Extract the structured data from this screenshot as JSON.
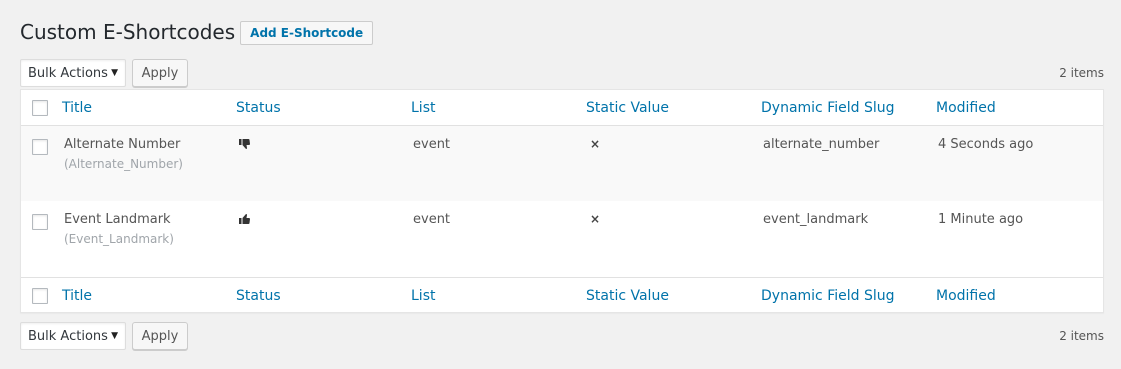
{
  "header": {
    "title": "Custom E-Shortcodes",
    "add_button": "Add E-Shortcode"
  },
  "tablenav_top": {
    "bulk_actions": "Bulk Actions",
    "apply": "Apply",
    "count": "2 items"
  },
  "tablenav_bottom": {
    "bulk_actions": "Bulk Actions",
    "apply": "Apply",
    "count": "2 items"
  },
  "columns": [
    "Title",
    "Status",
    "List",
    "Static Value",
    "Dynamic Field Slug",
    "Modified"
  ],
  "rows": [
    {
      "title": "Alternate Number",
      "shortcode": "(Alternate_Number)",
      "status_icon": "thumbs-down-icon",
      "list": "event",
      "static_value_icon": "close-icon",
      "static_value": "×",
      "slug": "alternate_number",
      "modified": "4 Seconds ago"
    },
    {
      "title": "Event Landmark",
      "shortcode": "(Event_Landmark)",
      "status_icon": "thumbs-up-icon",
      "list": "event",
      "static_value_icon": "close-icon",
      "static_value": "×",
      "slug": "event_landmark",
      "modified": "1 Minute ago"
    }
  ],
  "colors": {
    "link": "#0073aa",
    "background": "#f1f1f1",
    "muted": "#a0a5aa"
  }
}
